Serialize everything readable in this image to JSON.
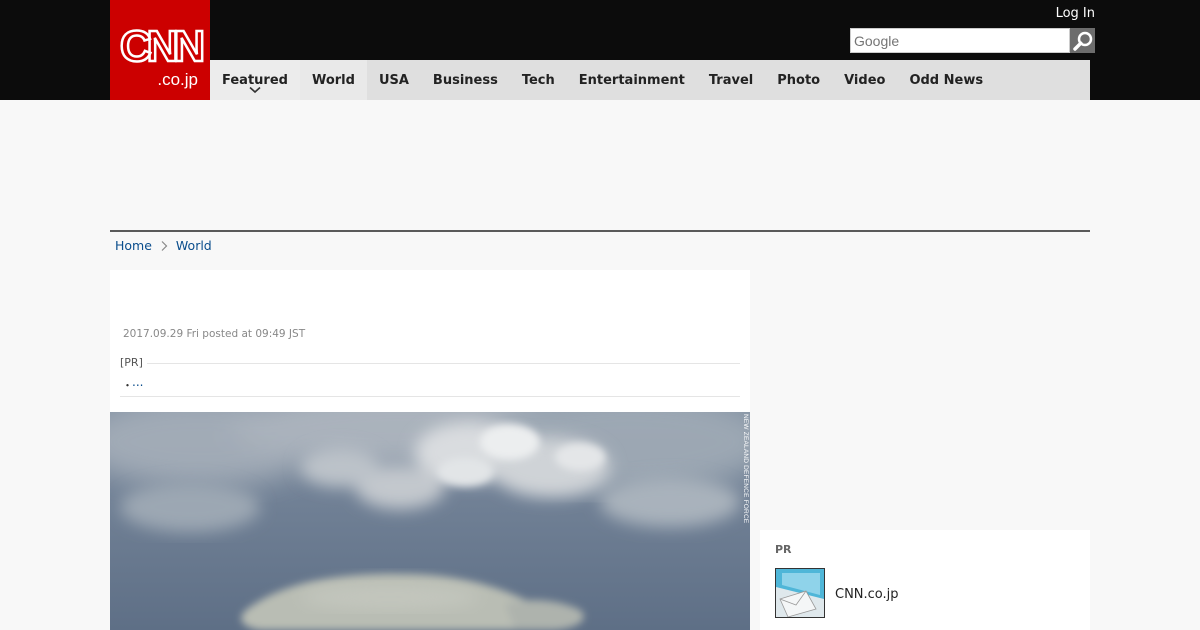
{
  "header": {
    "logo_main": "CNN",
    "logo_sub": ".co.jp",
    "login_label": "Log In",
    "search_placeholder": "Google"
  },
  "nav": {
    "items": [
      {
        "label": "Featured",
        "has_dropdown": true
      },
      {
        "label": "World"
      },
      {
        "label": "USA"
      },
      {
        "label": "Business"
      },
      {
        "label": "Tech"
      },
      {
        "label": "Entertainment"
      },
      {
        "label": "Travel"
      },
      {
        "label": "Photo"
      },
      {
        "label": "Video"
      },
      {
        "label": "Odd News"
      }
    ],
    "active": "World"
  },
  "breadcrumb": {
    "home": "Home",
    "current": "World"
  },
  "article": {
    "date": "2017.09.29 Fri posted at 09:49 JST",
    "pr_label": "[PR]",
    "pr_bullet": "・",
    "pr_link": "...",
    "photo_credit": "NEW ZEALAND DEFENCE FORCE"
  },
  "sidebar": {
    "pr_label": "PR",
    "item_text": "CNN.co.jp"
  },
  "colors": {
    "brand_red": "#cc0000",
    "topbar": "#0c0c0c",
    "nav_bg": "#dfdfdf",
    "link": "#0a4d8c"
  }
}
